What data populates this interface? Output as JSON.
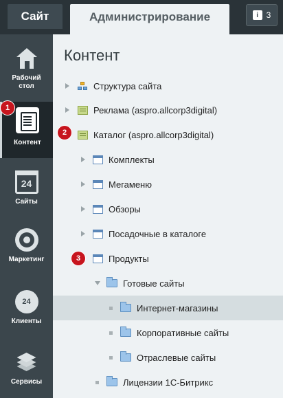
{
  "topbar": {
    "site_tab": "Сайт",
    "admin_tab": "Администрирование",
    "notifications_count": "3"
  },
  "sidebar": {
    "items": [
      {
        "label_line1": "Рабочий",
        "label_line2": "стол",
        "icon": "home-icon"
      },
      {
        "label_line1": "Контент",
        "label_line2": "",
        "icon": "document-icon",
        "active": true
      },
      {
        "label_line1": "Сайты",
        "label_line2": "",
        "icon": "calendar-icon"
      },
      {
        "label_line1": "Маркетинг",
        "label_line2": "",
        "icon": "target-icon"
      },
      {
        "label_line1": "Клиенты",
        "label_line2": "",
        "icon": "cloud-24-icon"
      },
      {
        "label_line1": "Сервисы",
        "label_line2": "",
        "icon": "layers-icon"
      }
    ],
    "calendar_icon_text": "24",
    "cloud_icon_text": "24"
  },
  "content": {
    "title": "Контент",
    "tree": [
      {
        "label": "Структура сайта",
        "icon": "structure-icon"
      },
      {
        "label": "Реклама (aspro.allcorp3digital)",
        "icon": "iblock-type-icon"
      },
      {
        "label": "Каталог (aspro.allcorp3digital)",
        "icon": "iblock-type-icon"
      },
      {
        "label": "Комплекты",
        "icon": "iblock-icon"
      },
      {
        "label": "Мегаменю",
        "icon": "iblock-icon"
      },
      {
        "label": "Обзоры",
        "icon": "iblock-icon"
      },
      {
        "label": "Посадочные в каталоге",
        "icon": "iblock-icon"
      },
      {
        "label": "Продукты",
        "icon": "iblock-icon"
      },
      {
        "label": "Готовые сайты",
        "icon": "folder-icon"
      },
      {
        "label": "Интернет-магазины",
        "icon": "folder-icon",
        "selected": true
      },
      {
        "label": "Корпоративные сайты",
        "icon": "folder-icon"
      },
      {
        "label": "Отраслевые сайты",
        "icon": "folder-icon"
      },
      {
        "label": "Лицензии 1С-Битрикс",
        "icon": "folder-icon"
      }
    ]
  },
  "badges": [
    "1",
    "2",
    "3"
  ],
  "colors": {
    "topbar": "#2a3338",
    "sidebar": "#3b464c",
    "sidebar_active": "#1f272b",
    "content_bg": "#eef2f4",
    "selected_row": "#d5dde0",
    "badge": "#c7151e"
  }
}
